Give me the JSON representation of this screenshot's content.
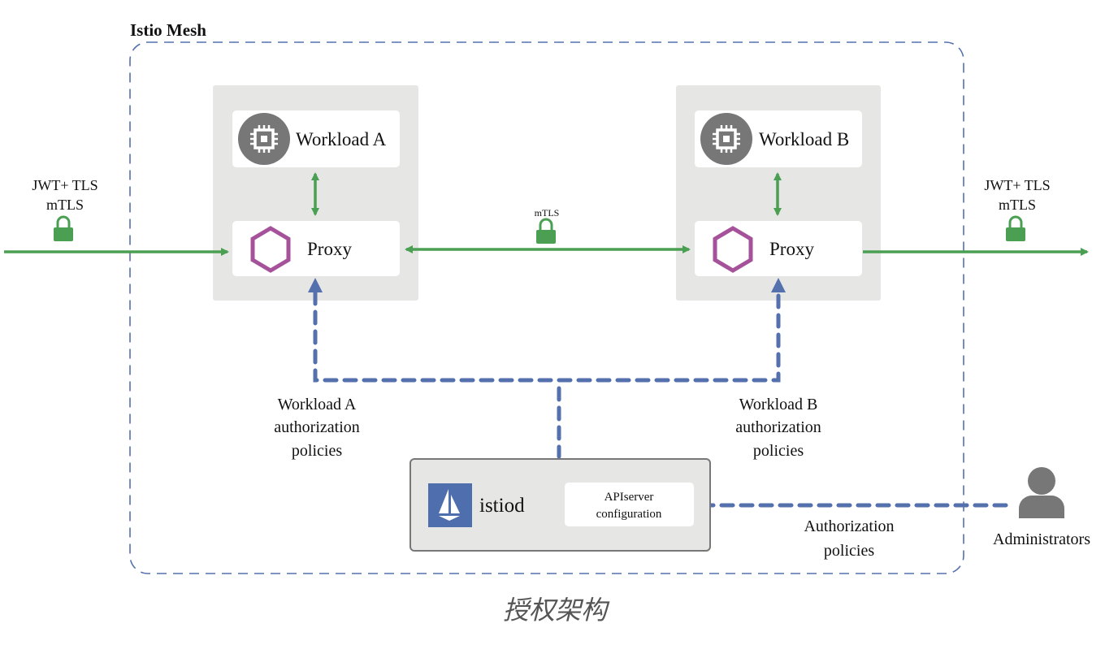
{
  "title": "Istio Mesh",
  "workload_a": {
    "name": "Workload A",
    "proxy": "Proxy",
    "policy_lines": [
      "Workload A",
      "authorization",
      "policies"
    ]
  },
  "workload_b": {
    "name": "Workload B",
    "proxy": "Proxy",
    "policy_lines": [
      "Workload B",
      "authorization",
      "policies"
    ]
  },
  "ingress": {
    "line1": "JWT+ TLS",
    "line2": "mTLS"
  },
  "egress": {
    "line1": "JWT+ TLS",
    "line2": "mTLS"
  },
  "mesh_link": {
    "label": "mTLS"
  },
  "istiod": {
    "name": "istiod",
    "config_lines": [
      "APIserver",
      "configuration"
    ]
  },
  "admin_flow": {
    "lines": [
      "Authorization",
      "policies"
    ]
  },
  "admin": {
    "label": "Administrators"
  },
  "caption": "授权架构",
  "colors": {
    "green": "#4a9f52",
    "blue": "#5470ad",
    "purple": "#a5529b",
    "grey_box": "#e6e6e5",
    "icon_grey": "#777777"
  }
}
